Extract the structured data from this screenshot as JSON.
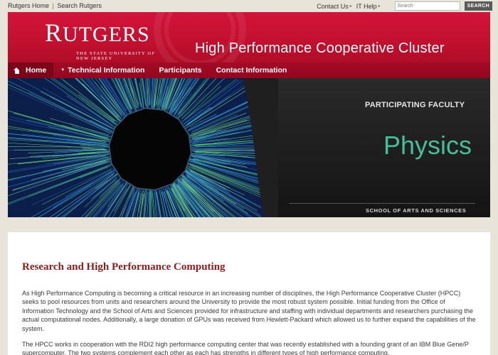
{
  "utility": {
    "left_links": [
      "Rutgers Home",
      "Search Rutgers"
    ],
    "separator": "|",
    "contact": "Contact Us",
    "it_help": "IT Help",
    "search_placeholder": "Search",
    "search_button": "SEARCH"
  },
  "header": {
    "logo_first": "R",
    "logo_rest": "UTGERS",
    "logo_subtitle": "THE STATE UNIVERSITY OF NEW JERSEY",
    "title": "High Performance Cooperative Cluster"
  },
  "nav": {
    "items": [
      {
        "label": "Home"
      },
      {
        "label": "Technical Information"
      },
      {
        "label": "Participants"
      },
      {
        "label": "Contact Information"
      }
    ]
  },
  "banner": {
    "participating": "PARTICIPATING FACULTY",
    "subject": "Physics",
    "school": "SCHOOL OF ARTS AND SCIENCES"
  },
  "content": {
    "heading": "Research and High Performance Computing",
    "paragraphs": [
      "As High Performance Computing is becoming a critical resource in an increasing number of disciplines, the High Performance Cooperative Cluster (HPCC) seeks to pool resources from units and researchers around the University to provide the most robust system possible. Initial funding from the Office of Information Technology and the School of Arts and Sciences provided for infrastructure and staffing with individual departments and researchers purchasing the actual computational nodes. Additionally, a large donation of GPUs was received from Hewlett-Packard which allowed us to further expand the capabilities of the system.",
      "The HPCC works in cooperation with the RDI2 high performance computing center that was recently established with a founding grant of an IBM Blue Gene/P supercomputer. The two systems complement each other as each has strengths in different types of high performance computing."
    ]
  }
}
